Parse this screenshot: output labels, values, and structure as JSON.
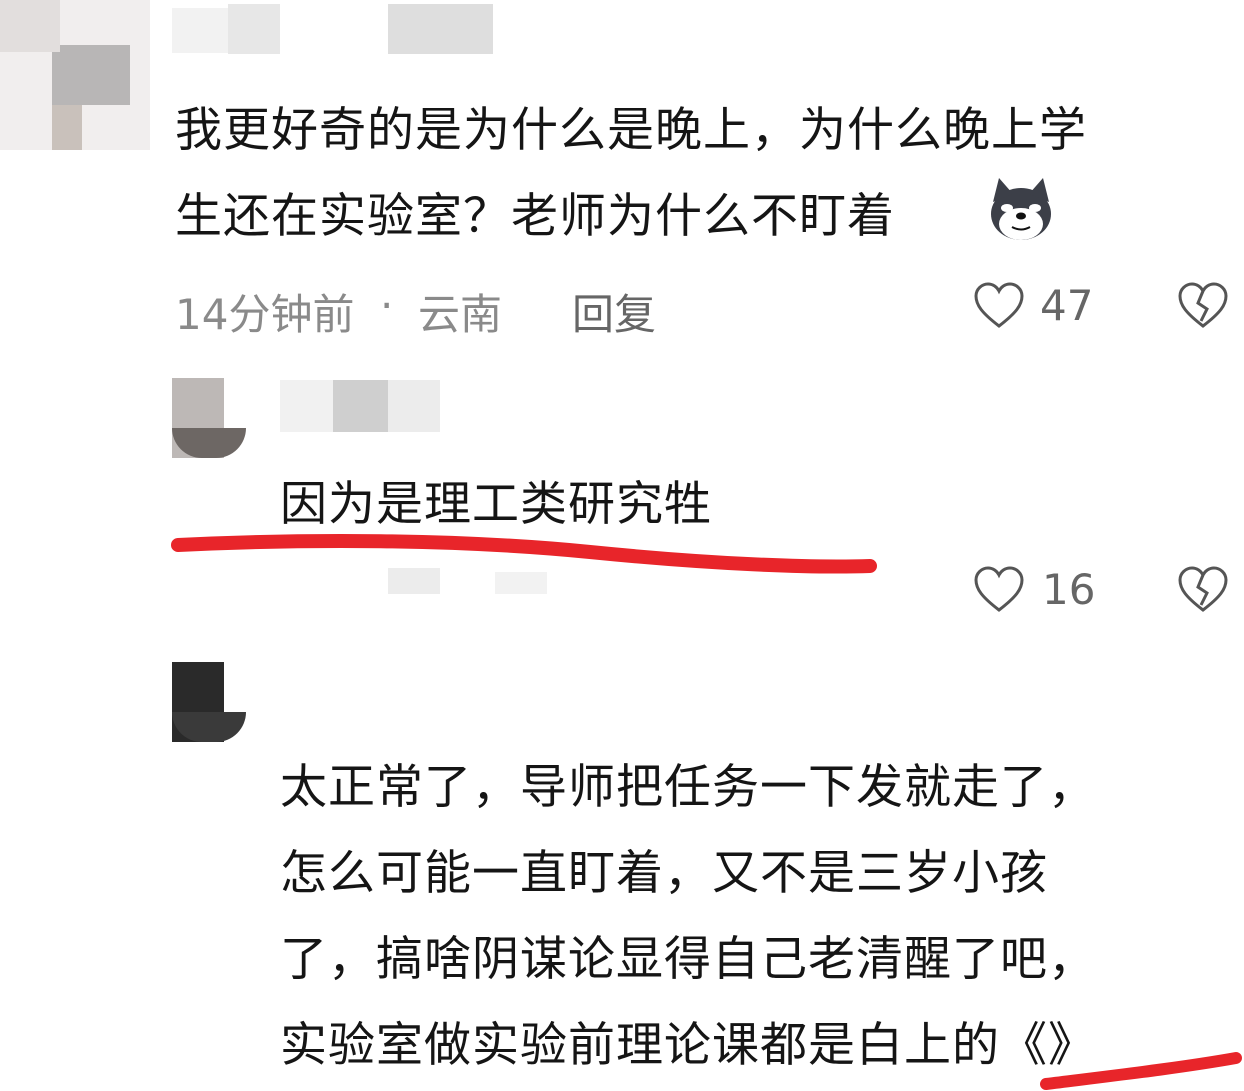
{
  "comments": [
    {
      "text_lines": [
        "我更好奇的是为什么是晚上，为什么晚上学",
        "生还在实验室？老师为什么不盯着"
      ],
      "time": "14分钟前",
      "dot": "·",
      "location": "云南",
      "reply_label": "回复",
      "likes": "47",
      "emoji": "dog-face-emoji"
    },
    {
      "text_lines": [
        "因为是理工类研究牲"
      ],
      "likes": "16"
    },
    {
      "text_lines": [
        "太正常了，导师把任务一下发就走了，",
        "怎么可能一直盯着，又不是三岁小孩",
        "了，搞啥阴谋论显得自己老清醒了吧，",
        "实验室做实验前理论课都是白上的《》"
      ]
    }
  ],
  "icons": {
    "like": "heart-outline-icon",
    "dislike": "broken-heart-icon"
  },
  "colors": {
    "annotation_red": "#e8252a",
    "meta_gray": "#8a8a8a"
  }
}
